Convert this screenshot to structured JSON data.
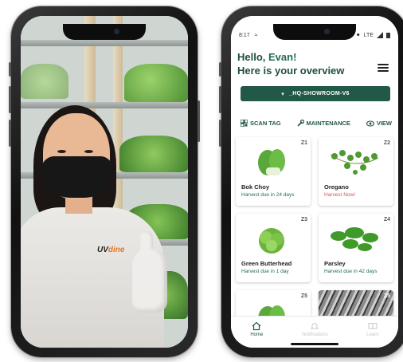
{
  "status_bar": {
    "time": "8:17",
    "network": "LTE"
  },
  "greeting": {
    "hello": "Hello, ",
    "name": "Evan!",
    "subtitle": "Here is your overview"
  },
  "location": {
    "label": "_HQ-SHOWROOM-V6"
  },
  "actions": [
    {
      "label": "SCAN TAG",
      "icon": "qr-icon"
    },
    {
      "label": "MAINTENANCE",
      "icon": "wrench-icon"
    },
    {
      "label": "VIEW",
      "icon": "eye-icon"
    }
  ],
  "cards": [
    {
      "zone": "Z1",
      "name": "Bok Choy",
      "harvest": "Harvest due in 24 days",
      "harvest_now": false
    },
    {
      "zone": "Z2",
      "name": "Oregano",
      "harvest": "Harvest Now!",
      "harvest_now": true
    },
    {
      "zone": "Z3",
      "name": "Green Butterhead",
      "harvest": "Harvest due in 1 day",
      "harvest_now": false
    },
    {
      "zone": "Z4",
      "name": "Parsley",
      "harvest": "Harvest due in 42 days",
      "harvest_now": false
    },
    {
      "zone": "Z5",
      "name": "",
      "harvest": ""
    },
    {
      "zone": "Z5",
      "name": "",
      "harvest": ""
    }
  ],
  "bottom_nav": [
    {
      "label": "Home",
      "active": true
    },
    {
      "label": "Notifications",
      "active": false
    },
    {
      "label": "Learn",
      "active": false
    }
  ],
  "shirt_logo": {
    "prefix": "UV",
    "suffix": "dine"
  },
  "colors": {
    "primary": "#215848",
    "accent_red": "#e04a5a",
    "text_green": "#1f6f52"
  }
}
